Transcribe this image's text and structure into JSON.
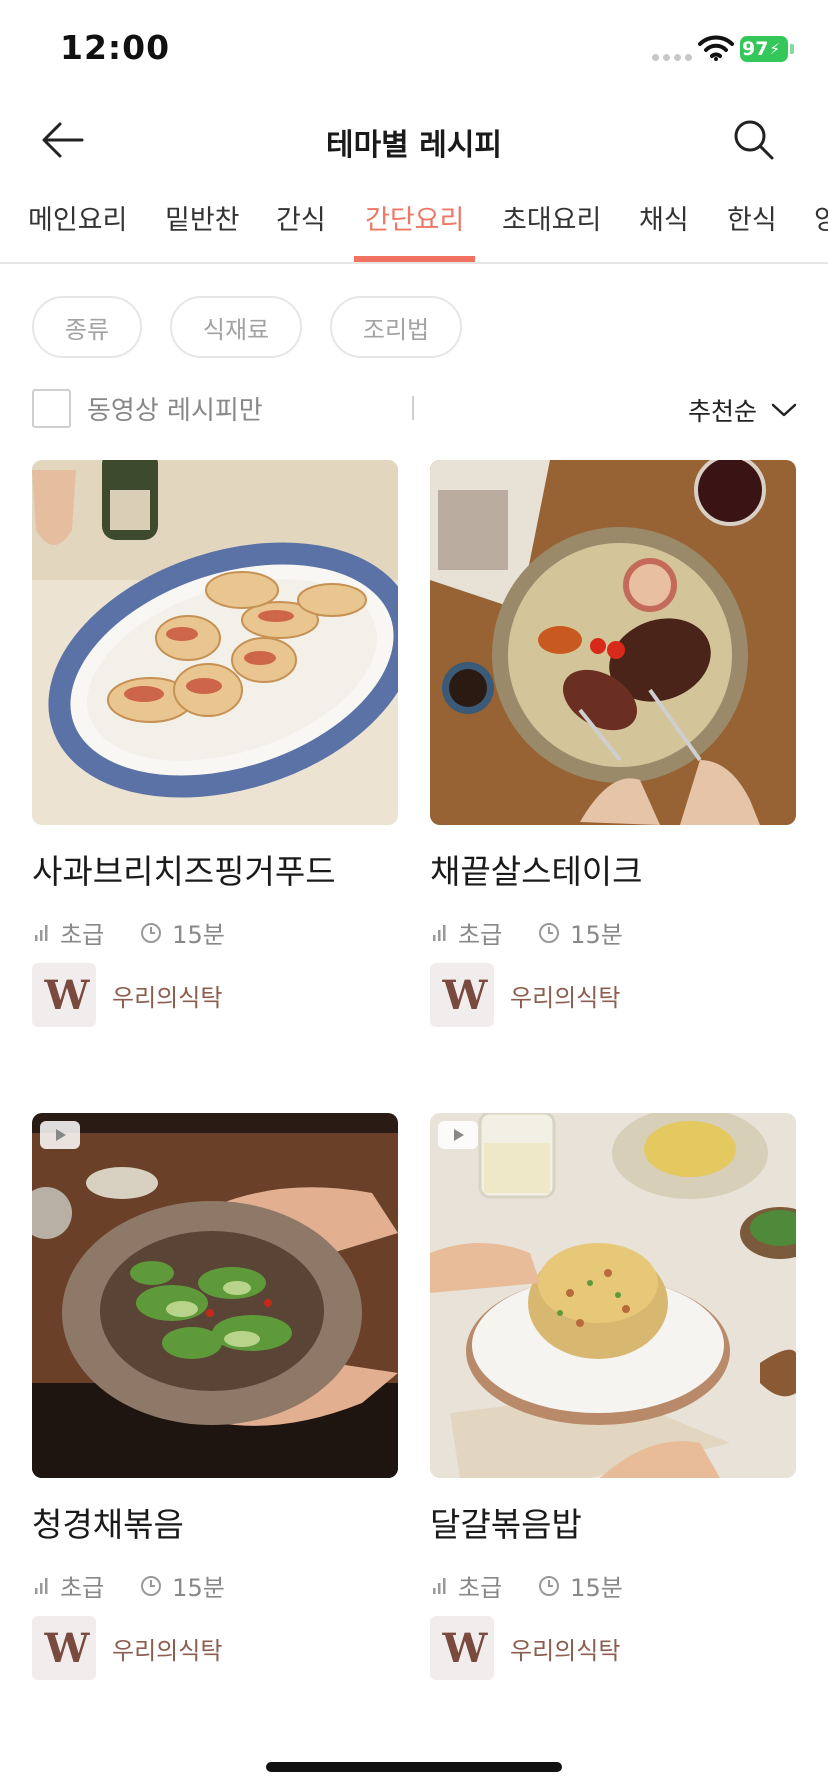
{
  "status_bar": {
    "time": "12:00",
    "battery": "97"
  },
  "header": {
    "title": "테마별 레시피"
  },
  "tabs": [
    {
      "label": "메인요리"
    },
    {
      "label": "밑반찬"
    },
    {
      "label": "간식"
    },
    {
      "label": "간단요리",
      "active": true
    },
    {
      "label": "초대요리"
    },
    {
      "label": "채식"
    },
    {
      "label": "한식"
    },
    {
      "label": "양"
    }
  ],
  "filters": {
    "chips": [
      "종류",
      "식재료",
      "조리법"
    ],
    "video_only_label": "동영상 레시피만",
    "video_only_checked": false,
    "sort_label": "추천순"
  },
  "recipes": [
    {
      "title": "사과브리치즈핑거푸드",
      "level": "초급",
      "time": "15분",
      "author": "우리의식탁",
      "logo": "W",
      "has_video": false,
      "image": "apple-brie-cheese-finger-food"
    },
    {
      "title": "채끝살스테이크",
      "level": "초급",
      "time": "15분",
      "author": "우리의식탁",
      "logo": "W",
      "has_video": false,
      "image": "sirloin-steak"
    },
    {
      "title": "청경채볶음",
      "level": "초급",
      "time": "15분",
      "author": "우리의식탁",
      "logo": "W",
      "has_video": true,
      "image": "stir-fried-bok-choy"
    },
    {
      "title": "달걀볶음밥",
      "level": "초급",
      "time": "15분",
      "author": "우리의식탁",
      "logo": "W",
      "has_video": true,
      "image": "egg-fried-rice"
    }
  ],
  "colors": {
    "accent": "#f27261",
    "author": "#8b5e4f",
    "muted": "#888888"
  },
  "icons": [
    "back-arrow-icon",
    "search-icon",
    "chevron-down-icon",
    "level-bars-icon",
    "clock-icon",
    "play-icon",
    "wifi-icon",
    "battery-icon"
  ]
}
